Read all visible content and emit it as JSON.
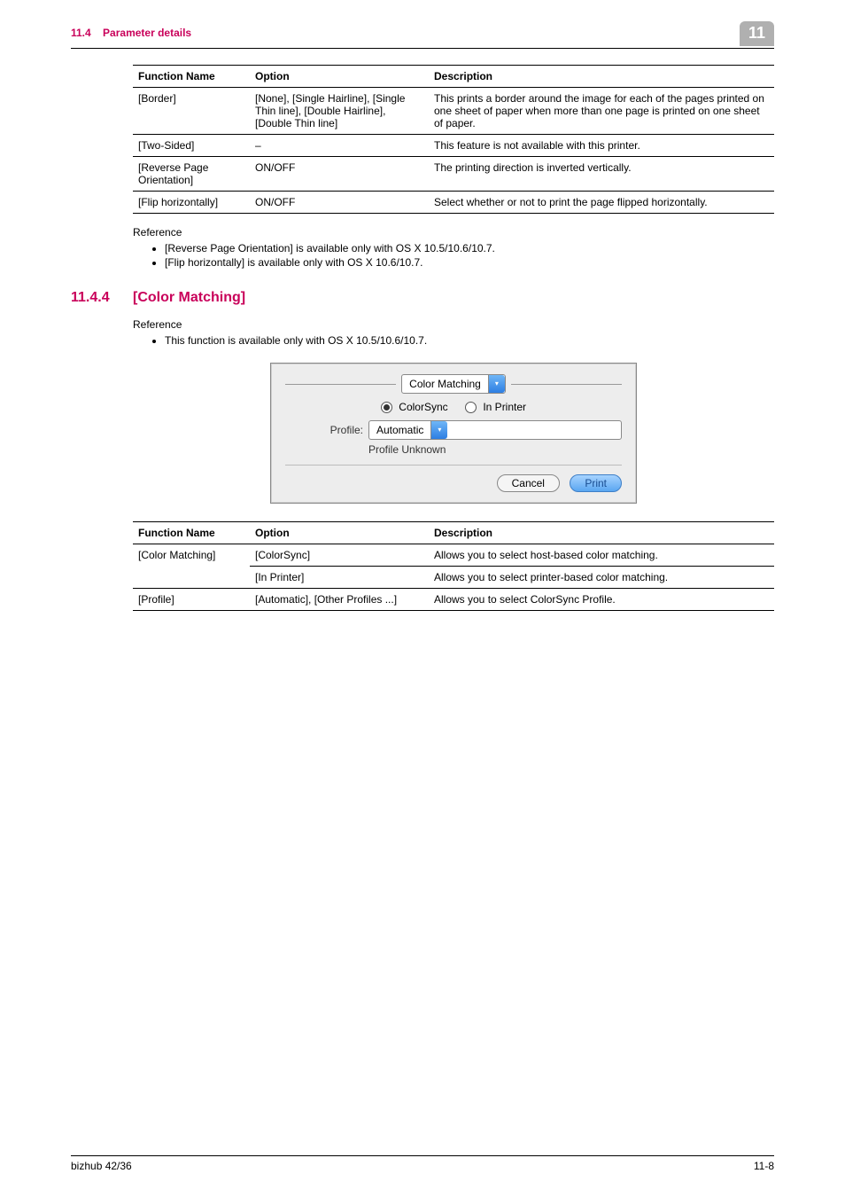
{
  "header": {
    "section_ref": "11.4",
    "section_title": "Parameter details",
    "chapter_badge": "11"
  },
  "table1": {
    "headers": {
      "fn": "Function Name",
      "op": "Option",
      "desc": "Description"
    },
    "rows": [
      {
        "fn": "[Border]",
        "op": "[None], [Single Hairline], [Single Thin line], [Double Hairline], [Double Thin line]",
        "desc": "This prints a border around the image for each of the pages printed on one sheet of paper when more than one page is printed on one sheet of paper."
      },
      {
        "fn": "[Two-Sided]",
        "op": "–",
        "desc": "This feature is not available with this printer."
      },
      {
        "fn": "[Reverse Page Orientation]",
        "op": "ON/OFF",
        "desc": "The printing direction is inverted vertically."
      },
      {
        "fn": "[Flip horizontally]",
        "op": "ON/OFF",
        "desc": "Select whether or not to print the page flipped horizontally."
      }
    ]
  },
  "reference1": {
    "title": "Reference",
    "items": [
      "[Reverse Page Orientation] is available only with OS X 10.5/10.6/10.7.",
      "[Flip horizontally] is available only with OS X 10.6/10.7."
    ]
  },
  "section": {
    "number": "11.4.4",
    "title": "[Color Matching]"
  },
  "reference2": {
    "title": "Reference",
    "items": [
      "This function is available only with OS X 10.5/10.6/10.7."
    ]
  },
  "dialog": {
    "panel_select": "Color Matching",
    "radio1": "ColorSync",
    "radio2": "In Printer",
    "profile_label": "Profile:",
    "profile_value": "Automatic",
    "profile_unknown": "Profile Unknown",
    "cancel": "Cancel",
    "print": "Print"
  },
  "table2": {
    "headers": {
      "fn": "Function Name",
      "op": "Option",
      "desc": "Description"
    },
    "rows": [
      {
        "fn": "[Color Matching]",
        "op": "[ColorSync]",
        "desc": "Allows you to select host-based color matching."
      },
      {
        "fn": "",
        "op": "[In Printer]",
        "desc": "Allows you to select printer-based color matching."
      },
      {
        "fn": "[Profile]",
        "op": "[Automatic], [Other Profiles ...]",
        "desc": "Allows you to select ColorSync Profile."
      }
    ]
  },
  "footer": {
    "left": "bizhub 42/36",
    "right": "11-8"
  }
}
